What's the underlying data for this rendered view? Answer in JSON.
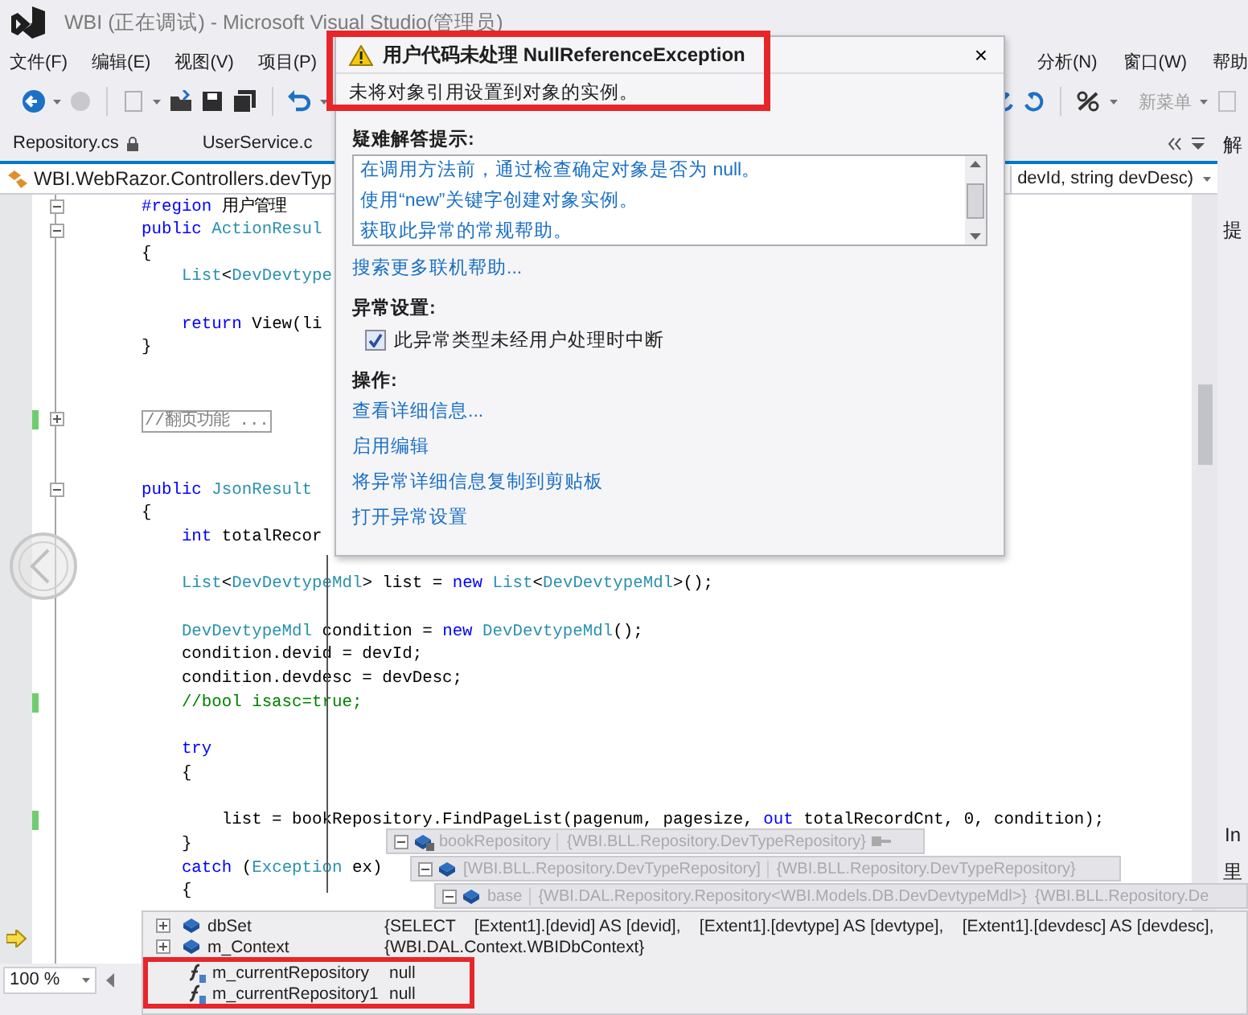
{
  "window": {
    "title": "WBI (正在调试) - Microsoft Visual Studio(管理员)"
  },
  "menu": {
    "left": [
      "文件(F)",
      "编辑(E)",
      "视图(V)",
      "项目(P)"
    ],
    "right": [
      "分析(N)",
      "窗口(W)",
      "帮助"
    ]
  },
  "toolbar": {
    "new_menu": "新菜单"
  },
  "tabs": [
    {
      "label": "Repository.cs",
      "selected": false,
      "locked": true
    },
    {
      "label": "UserService.c",
      "selected": false,
      "locked": false
    }
  ],
  "nav": {
    "type": "WBI.WebRazor.Controllers.devTyp",
    "member": "devId, string devDesc)"
  },
  "code": [
    {
      "expanded": true,
      "changed": false,
      "current": false,
      "tokens": [
        {
          "kind": "keyword",
          "text": "#region"
        },
        {
          "kind": "plain",
          "text": " 用户管理"
        }
      ]
    },
    {
      "expanded": true,
      "changed": false,
      "current": false,
      "tokens": [
        {
          "kind": "keyword",
          "text": "public"
        },
        {
          "kind": "type",
          "text": " ActionResul"
        }
      ]
    },
    {
      "changed": false,
      "current": false,
      "tokens": [
        {
          "kind": "plain",
          "text": "{"
        }
      ]
    },
    {
      "changed": false,
      "current": false,
      "tokens": [
        {
          "kind": "type",
          "text": "    List"
        },
        {
          "kind": "plain",
          "text": "<"
        },
        {
          "kind": "type",
          "text": "DevDevtype"
        }
      ]
    },
    {
      "changed": false,
      "current": false
    },
    {
      "changed": false,
      "current": false,
      "tokens": [
        {
          "kind": "keyword",
          "text": "    return"
        },
        {
          "kind": "plain",
          "text": " View(li"
        }
      ]
    },
    {
      "changed": false,
      "current": false,
      "tokens": [
        {
          "kind": "plain",
          "text": "}"
        }
      ]
    },
    {
      "changed": false,
      "current": false
    },
    {
      "changed": false,
      "current": false
    },
    {
      "expanded": false,
      "changed": true,
      "current": false,
      "tokens": [
        {
          "kind": "collapsed",
          "text": "//翻页功能 ..."
        }
      ]
    },
    {
      "changed": false,
      "current": false
    },
    {
      "changed": false,
      "current": false
    },
    {
      "expanded": true,
      "changed": false,
      "current": false,
      "tokens": [
        {
          "kind": "keyword",
          "text": "public"
        },
        {
          "kind": "type",
          "text": " JsonResult"
        }
      ]
    },
    {
      "changed": false,
      "current": false,
      "tokens": [
        {
          "kind": "plain",
          "text": "{"
        }
      ]
    },
    {
      "changed": false,
      "current": false,
      "tokens": [
        {
          "kind": "keyword",
          "text": "    int"
        },
        {
          "kind": "plain",
          "text": " totalRecor"
        }
      ]
    },
    {
      "changed": false,
      "current": false
    },
    {
      "changed": false,
      "current": false,
      "tokens": [
        {
          "kind": "type",
          "text": "    List"
        },
        {
          "kind": "plain",
          "text": "<"
        },
        {
          "kind": "type",
          "text": "DevDevtypeMdl"
        },
        {
          "kind": "plain",
          "text": "> list = "
        },
        {
          "kind": "keyword",
          "text": "new"
        },
        {
          "kind": "type",
          "text": " List"
        },
        {
          "kind": "plain",
          "text": "<"
        },
        {
          "kind": "type",
          "text": "DevDevtypeMdl"
        },
        {
          "kind": "plain",
          "text": ">();"
        }
      ]
    },
    {
      "changed": false,
      "current": false
    },
    {
      "changed": false,
      "current": false,
      "tokens": [
        {
          "kind": "type",
          "text": "    DevDevtypeMdl"
        },
        {
          "kind": "plain",
          "text": " condition = "
        },
        {
          "kind": "keyword",
          "text": "new"
        },
        {
          "kind": "type",
          "text": " DevDevtypeMdl"
        },
        {
          "kind": "plain",
          "text": "();"
        }
      ]
    },
    {
      "changed": false,
      "current": false,
      "tokens": [
        {
          "kind": "plain",
          "text": "    condition.devid = devId;"
        }
      ]
    },
    {
      "changed": false,
      "current": false,
      "tokens": [
        {
          "kind": "plain",
          "text": "    condition.devdesc = devDesc;"
        }
      ]
    },
    {
      "changed": true,
      "current": false,
      "tokens": [
        {
          "kind": "comment",
          "text": "    //bool isasc=true;"
        }
      ]
    },
    {
      "changed": false,
      "current": false
    },
    {
      "changed": false,
      "current": false,
      "tokens": [
        {
          "kind": "keyword",
          "text": "    try"
        }
      ]
    },
    {
      "changed": false,
      "current": false,
      "tokens": [
        {
          "kind": "plain",
          "text": "    {"
        }
      ]
    },
    {
      "changed": false,
      "current": false
    },
    {
      "changed": true,
      "current": false,
      "tokens": [
        {
          "kind": "plain",
          "text": "        list = bookRepository.FindPageList(pagenum, pagesize, "
        },
        {
          "kind": "keyword",
          "text": "out"
        },
        {
          "kind": "plain",
          "text": " totalRecordCnt, 0, condition);"
        }
      ]
    },
    {
      "changed": false,
      "current": false,
      "tokens": [
        {
          "kind": "plain",
          "text": "    }"
        }
      ]
    },
    {
      "changed": false,
      "current": false,
      "tokens": [
        {
          "kind": "keyword",
          "text": "    catch"
        },
        {
          "kind": "plain",
          "text": " ("
        },
        {
          "kind": "type",
          "text": "Exception"
        },
        {
          "kind": "plain",
          "text": " ex)"
        }
      ]
    },
    {
      "changed": false,
      "current": false,
      "tokens": [
        {
          "kind": "plain",
          "text": "    {"
        }
      ]
    },
    {
      "changed": false,
      "current": false
    },
    {
      "changed": false,
      "current": true
    }
  ],
  "side_panel": [
    "解",
    "提",
    "In",
    "里"
  ],
  "zoom": "100 %",
  "exception": {
    "title": "用户代码未处理 NullReferenceException",
    "close": "×",
    "message": "未将对象引用设置到对象的实例。",
    "highlighted": true,
    "tips_heading": "疑难解答提示:",
    "tips": [
      "在调用方法前，通过检查确定对象是否为 null。",
      "使用“new”关键字创建对象实例。",
      "获取此异常的常规帮助。"
    ],
    "search_link": "搜索更多联机帮助...",
    "settings_heading": "异常设置:",
    "break_option": {
      "label": "此异常类型未经用户处理时中断",
      "checked": true
    },
    "actions_heading": "操作:",
    "actions": [
      "查看详细信息...",
      "启用编辑",
      "将异常详细信息复制到剪贴板",
      "打开异常设置"
    ]
  },
  "datatip": {
    "name": "bookRepository",
    "value": "{WBI.BLL.Repository.DevTypeRepository}",
    "kind": "object",
    "expanded": true,
    "children": [
      {
        "name": "[WBI.BLL.Repository.DevTypeRepository]",
        "value": "{WBI.BLL.Repository.DevTypeRepository}",
        "kind": "object",
        "expanded": true,
        "children": [
          {
            "name": "base",
            "value": "{WBI.DAL.Repository.Repository<WBI.Models.DB.DevDevtypeMdl>}",
            "extra": "{WBI.BLL.Repository.De",
            "kind": "object",
            "expanded": true,
            "children": [
              {
                "name": "dbSet",
                "value": "{SELECT    [Extent1].[devid] AS [devid],    [Extent1].[devtype] AS [devtype],    [Extent1].[devdesc] AS [devdesc],",
                "kind": "object",
                "expanded": false,
                "highlighted": false
              },
              {
                "name": "m_Context",
                "value": "{WBI.DAL.Context.WBIDbContext}",
                "kind": "object",
                "expanded": false,
                "highlighted": false
              },
              {
                "name": "m_currentRepository",
                "value": "null",
                "kind": "field",
                "highlighted": true
              },
              {
                "name": "m_currentRepository1",
                "value": "null",
                "kind": "field",
                "highlighted": true
              }
            ]
          }
        ]
      }
    ]
  }
}
